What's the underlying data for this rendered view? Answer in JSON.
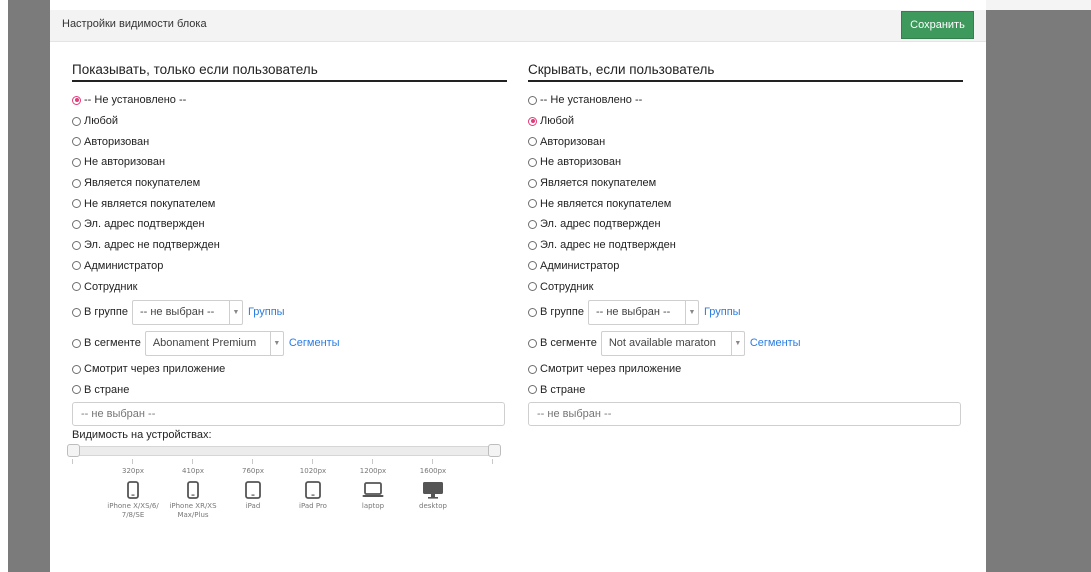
{
  "header": {
    "title": "Настройки видимости блока",
    "save_label": "Сохранить"
  },
  "show_panel": {
    "title": "Показывать, только если пользователь",
    "options": [
      "-- Не установлено --",
      "Любой",
      "Авторизован",
      "Не авторизован",
      "Является покупателем",
      "Не является покупателем",
      "Эл. адрес подтвержден",
      "Эл. адрес не подтвержден",
      "Администратор",
      "Сотрудник"
    ],
    "selected_index": 0,
    "group": {
      "label": "В группе",
      "value": "-- не выбран --",
      "link": "Группы"
    },
    "segment": {
      "label": "В сегменте",
      "value": "Abonament Premium",
      "link": "Сегменты"
    },
    "app": "Смотрит через приложение",
    "country": {
      "label": "В стране",
      "placeholder": "-- не выбран --"
    }
  },
  "hide_panel": {
    "title": "Скрывать, если пользователь",
    "options": [
      "-- Не установлено --",
      "Любой",
      "Авторизован",
      "Не авторизован",
      "Является покупателем",
      "Не является покупателем",
      "Эл. адрес подтвержден",
      "Эл. адрес не подтвержден",
      "Администратор",
      "Сотрудник"
    ],
    "selected_index": 1,
    "group": {
      "label": "В группе",
      "value": "-- не выбран --",
      "link": "Группы"
    },
    "segment": {
      "label": "В сегменте",
      "value": "Not available maraton",
      "link": "Сегменты"
    },
    "app": "Смотрит через приложение",
    "country": {
      "label": "В стране",
      "placeholder": "-- не выбран --"
    }
  },
  "devices": {
    "label": "Видимость на устройствах:",
    "range_min": 0,
    "range_max": 1,
    "breakpoints": [
      {
        "size": "320px",
        "name": "iPhone X/XS/6/ 7/8/SE",
        "icon": "phone-icon"
      },
      {
        "size": "410px",
        "name": "iPhone XR/XS Max/Plus",
        "icon": "phone-icon"
      },
      {
        "size": "760px",
        "name": "iPad",
        "icon": "tablet-icon"
      },
      {
        "size": "1020px",
        "name": "iPad Pro",
        "icon": "tablet-icon"
      },
      {
        "size": "1200px",
        "name": "laptop",
        "icon": "laptop-icon"
      },
      {
        "size": "1600px",
        "name": "desktop",
        "icon": "desktop-icon"
      }
    ]
  },
  "colors": {
    "accent_radio": "#e33b7a",
    "save_button": "#3d9a5c",
    "link": "#2a7de1",
    "backdrop": "#7b7b7b"
  }
}
